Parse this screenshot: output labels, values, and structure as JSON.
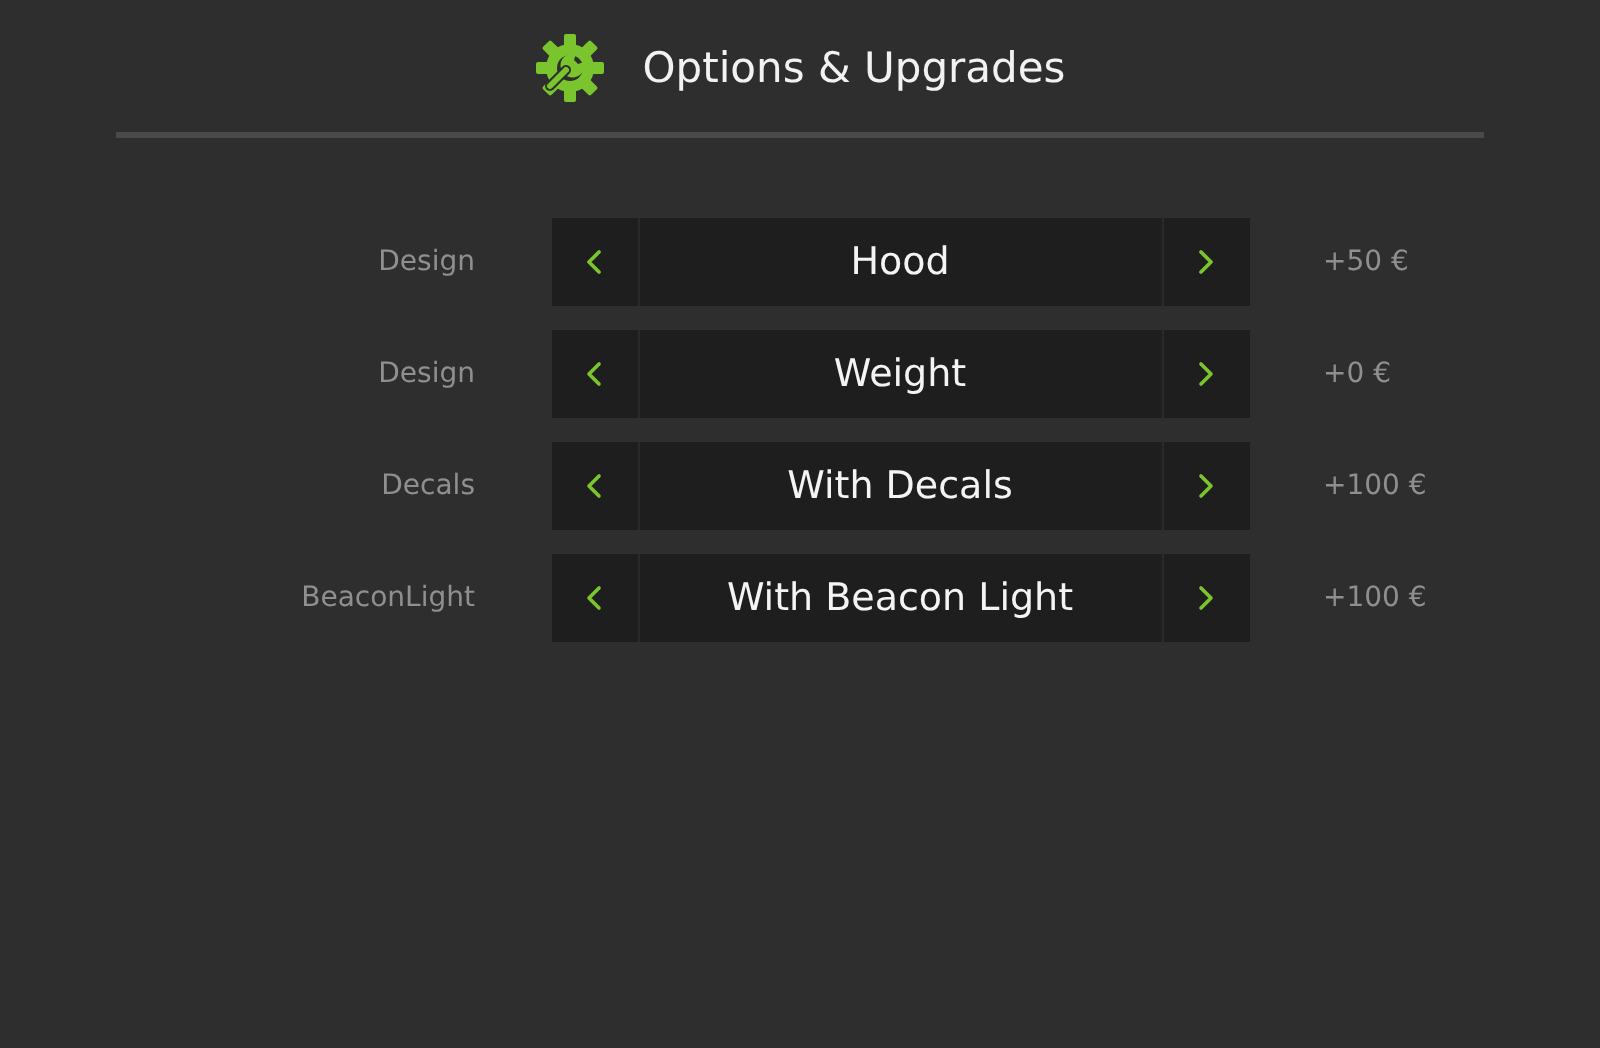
{
  "header": {
    "title": "Options & Upgrades"
  },
  "options": [
    {
      "label": "Design",
      "value": "Hood",
      "price": "+50 €"
    },
    {
      "label": "Design",
      "value": "Weight",
      "price": "+0 €"
    },
    {
      "label": "Decals",
      "value": "With Decals",
      "price": "+100 €"
    },
    {
      "label": "BeaconLight",
      "value": "With Beacon Light",
      "price": "+100 €"
    }
  ]
}
